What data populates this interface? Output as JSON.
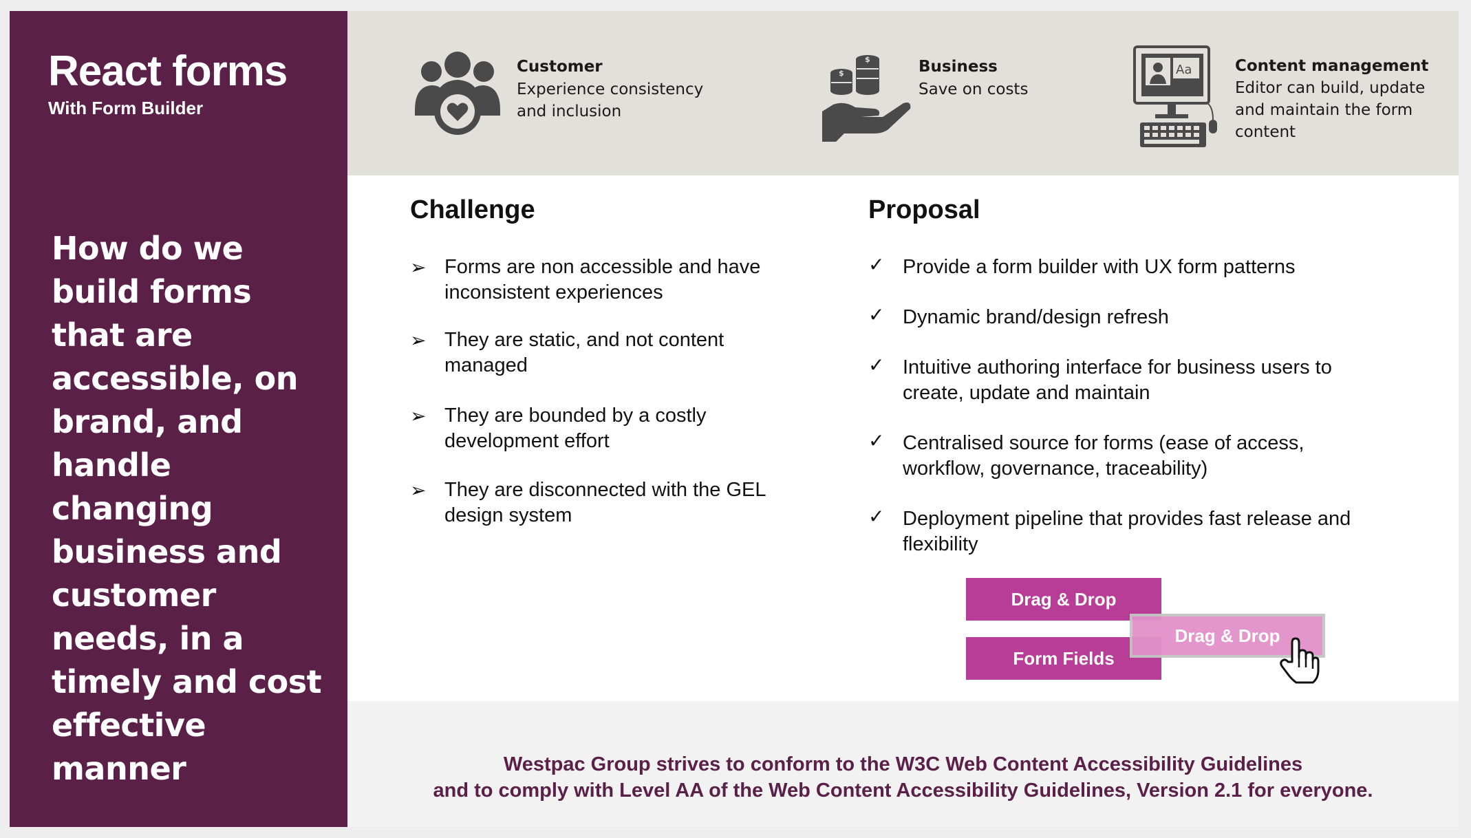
{
  "sidebar": {
    "title": "React forms",
    "subtitle": "With Form Builder",
    "question": "How do we build forms that are accessible, on brand, and handle changing business and customer needs, in a timely and cost effective manner"
  },
  "benefits": [
    {
      "title": "Customer",
      "description": "Experience consistency and inclusion",
      "icon": "customer-heart-icon"
    },
    {
      "title": "Business",
      "description": "Save on costs",
      "icon": "hand-coins-icon"
    },
    {
      "title": "Content management",
      "description": "Editor can build, update and maintain the form content",
      "icon": "computer-editor-icon"
    }
  ],
  "challenge": {
    "title": "Challenge",
    "bullet": "➢",
    "items": [
      "Forms are non accessible and have inconsistent experiences",
      "They are static, and not content managed",
      "They are bounded by a costly development effort",
      "They are disconnected with the GEL design system"
    ]
  },
  "proposal": {
    "title": "Proposal",
    "bullet": "✓",
    "items": [
      "Provide a form builder with UX form patterns",
      "Dynamic brand/design refresh",
      "Intuitive authoring interface for business users to create, update and maintain",
      "Centralised source for forms (ease of access, workflow, governance, traceability)",
      "Deployment pipeline that provides fast release and flexibility"
    ]
  },
  "illustration": {
    "drag_drop_label": "Drag & Drop",
    "form_fields_label": "Form Fields",
    "dragging_label": "Drag & Drop"
  },
  "footer": {
    "line1": "Westpac Group strives to conform to the W3C Web Content Accessibility Guidelines",
    "line2": "and to comply with Level AA of the Web Content Accessibility Guidelines, Version 2.1 for everyone."
  },
  "colors": {
    "brand": "#5a2048",
    "accent": "#b83d96",
    "band": "#e2e0db"
  }
}
